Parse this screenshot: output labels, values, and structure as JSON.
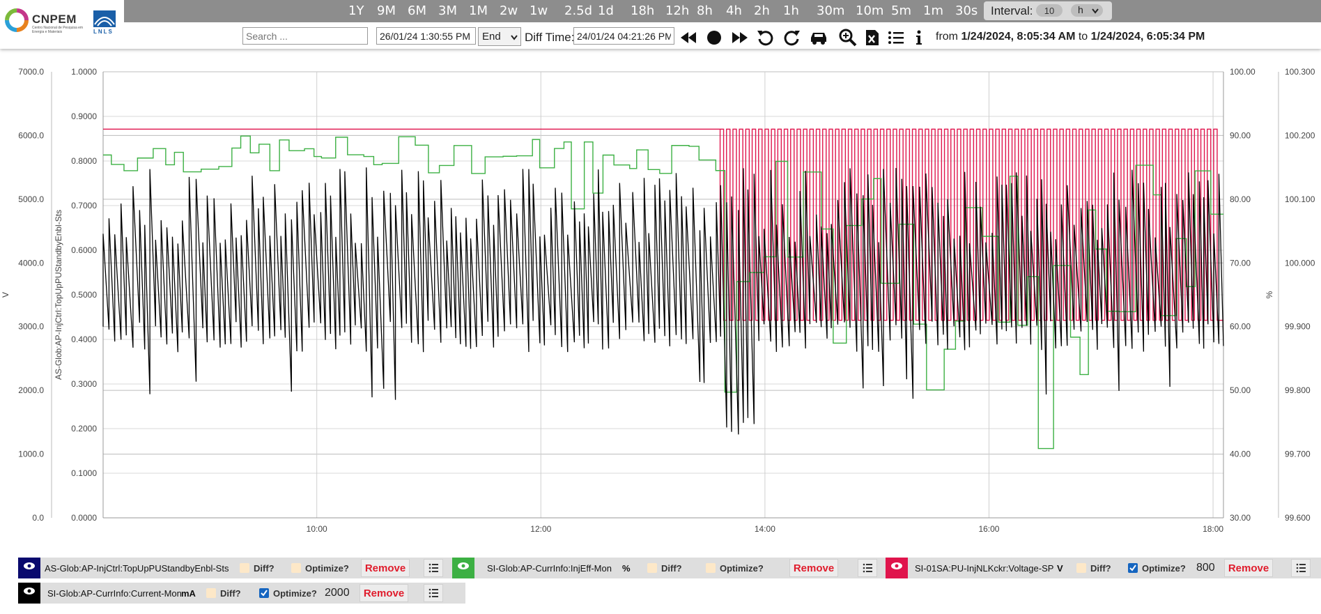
{
  "header": {
    "logo_text": "CNPEM",
    "logo_subtext": "Centro Nacional de Pesquisa em Energia e Materiais",
    "lnls_text": "LNLS",
    "ranges": [
      "1Y",
      "9M",
      "6M",
      "3M",
      "1M",
      "2w",
      "1w",
      "2.5d",
      "1d",
      "18h",
      "12h",
      "8h",
      "4h",
      "2h",
      "1h",
      "30m",
      "10m",
      "5m",
      "1m",
      "30s"
    ],
    "interval_label": "Interval:",
    "interval_value": "10",
    "interval_unit": "h"
  },
  "toolbar": {
    "search_placeholder": "Search ...",
    "date_value": "26/01/24 1:30:55 PM",
    "end_select": "End",
    "diff_label": "Diff Time:",
    "diff_value": "24/01/24 04:21:26 PM",
    "range_from_label": "from",
    "range_from": "1/24/2024, 8:05:34 AM",
    "range_to_label": "to",
    "range_to": "1/24/2024, 6:05:34 PM"
  },
  "chart_data": {
    "type": "line",
    "x_range": [
      "08:05:34",
      "18:05:34"
    ],
    "x_ticks": [
      "10:00",
      "12:00",
      "14:00",
      "16:00",
      "18:00"
    ],
    "axes": {
      "left_outer": {
        "unit": "V",
        "ticks": [
          "0.0",
          "1000.0",
          "2000.0",
          "3000.0",
          "4000.0",
          "5000.0",
          "6000.0",
          "7000.0"
        ],
        "range": [
          0,
          7000
        ]
      },
      "left_inner": {
        "label": "AS-Glob:AP-InjCtrl:TopUpPUStandbyEnbl-Sts",
        "ticks": [
          "0.0000",
          "0.1000",
          "0.2000",
          "0.3000",
          "0.4000",
          "0.5000",
          "0.6000",
          "0.7000",
          "0.8000",
          "0.9000",
          "1.0000"
        ],
        "range": [
          0,
          1
        ]
      },
      "right_inner": {
        "unit": "%",
        "ticks": [
          "30.00",
          "40.00",
          "50.00",
          "60.00",
          "70.00",
          "80.00",
          "90.00",
          "100.00"
        ],
        "range": [
          30,
          100
        ]
      },
      "right_outer": {
        "ticks": [
          "99.600",
          "99.700",
          "99.800",
          "99.900",
          "100.000",
          "100.100",
          "100.200",
          "100.300"
        ],
        "range": [
          99.6,
          100.3
        ]
      }
    },
    "series": [
      {
        "name": "SI-Glob:AP-CurrInfo:Current-Mon",
        "color": "#000000",
        "axis": "right_outer",
        "description_values": "oscillating sawtooth ~99.84-100.14 mA, dips to ~99.73 near 14:00"
      },
      {
        "name": "SI-Glob:AP-CurrInfo:InjEff-Mon",
        "color": "#3cb043",
        "axis": "right_inner",
        "approx_range": [
          35,
          92
        ]
      },
      {
        "name": "SI-01SA:PU-InjNLKckr:Voltage-SP",
        "color": "#e0144c",
        "axis": "left_outer",
        "values_note": "constant ~6100 V until ~13:35, then alternating 6100 / 3100 V"
      },
      {
        "name": "AS-Glob:AP-InjCtrl:TopUpPUStandbyEnbl-Sts",
        "color": "#000080",
        "axis": "left_inner",
        "hidden": true
      }
    ],
    "grid": true
  },
  "legend": [
    {
      "color": "#0a0a6e",
      "name": "AS-Glob:AP-InjCtrl:TopUpPUStandbyEnbl-Sts",
      "unit": "",
      "diff": "Diff?",
      "optimize": "Optimize?",
      "optimize_checked": false,
      "number": "",
      "remove": "Remove"
    },
    {
      "color": "#3cb043",
      "name": "SI-Glob:AP-CurrInfo:InjEff-Mon",
      "unit": "%",
      "diff": "Diff?",
      "optimize": "Optimize?",
      "optimize_checked": false,
      "number": "",
      "remove": "Remove"
    },
    {
      "color": "#e0144c",
      "name": "SI-01SA:PU-InjNLKckr:Voltage-SP",
      "unit": "V",
      "diff": "Diff?",
      "optimize": "Optimize?",
      "optimize_checked": true,
      "number": "800",
      "remove": "Remove"
    },
    {
      "color": "#000000",
      "name": "SI-Glob:AP-CurrInfo:Current-Mon",
      "unit": "mA",
      "diff": "Diff?",
      "optimize": "Optimize?",
      "optimize_checked": true,
      "number": "2000",
      "remove": "Remove"
    }
  ]
}
